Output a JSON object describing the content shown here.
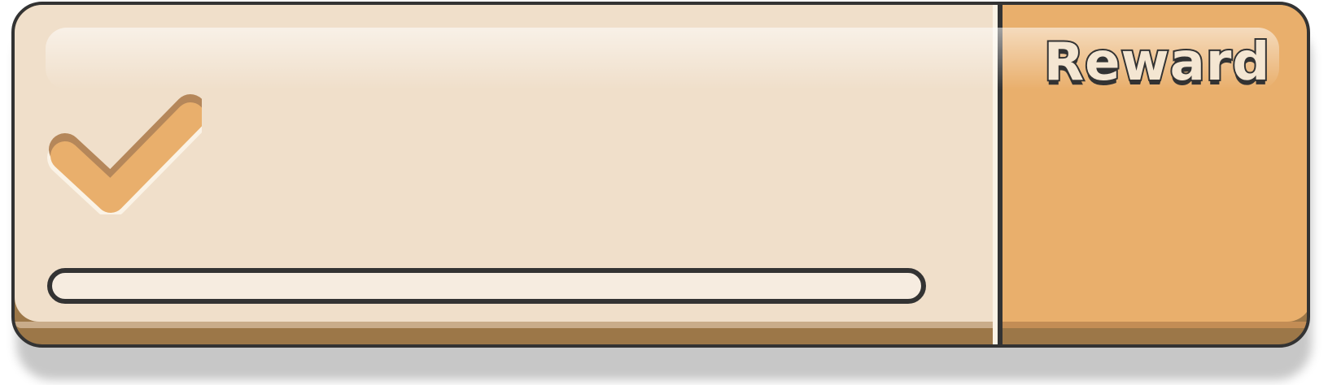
{
  "reward_panel": {
    "label": "Reward"
  },
  "task": {
    "status_icon": "checkmark-icon",
    "progress": 0
  },
  "colors": {
    "panel_light": "#f0dfca",
    "panel_accent": "#e9af6c",
    "outline": "#333333",
    "base": "#9c7748"
  }
}
